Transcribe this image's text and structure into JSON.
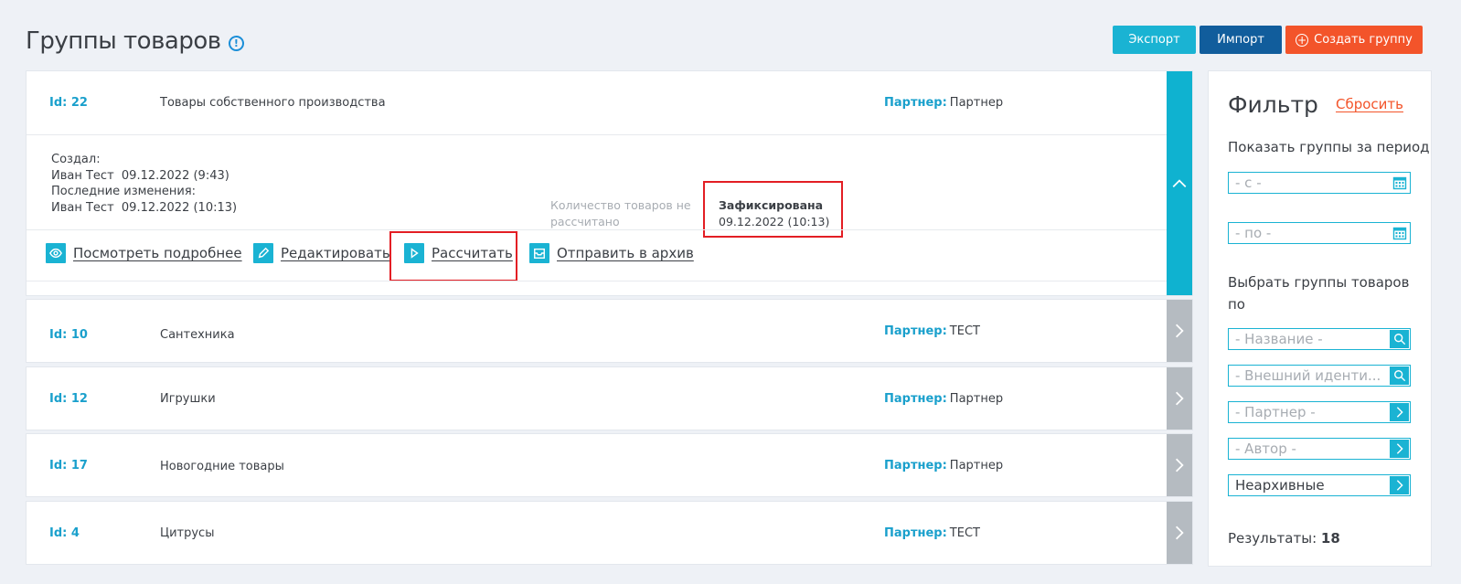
{
  "page": {
    "title": "Группы товаров"
  },
  "toolbar": {
    "export_label": "Экспорт",
    "import_label": "Импорт",
    "create_label": "Создать группу"
  },
  "groups": [
    {
      "id": "Id: 22",
      "name": "Товары собственного производства",
      "partner_label": "Партнер:",
      "partner": "Партнер",
      "created_label": "Создал:",
      "created_by": "Иван Тест  09.12.2022 (9:43)",
      "modified_label": "Последние изменения:",
      "modified_by": "Иван Тест  09.12.2022 (10:13)",
      "qty_status": "Количество товаров не рассчитано",
      "status_title": "Зафиксирована",
      "status_date": "09.12.2022 (10:13)",
      "actions": {
        "view": "Посмотреть подробнее",
        "edit": "Редактировать",
        "calculate": "Рассчитать",
        "archive": "Отправить в архив"
      }
    },
    {
      "id": "Id: 10",
      "name": "Сантехника",
      "partner_label": "Партнер:",
      "partner": "ТЕСТ"
    },
    {
      "id": "Id: 12",
      "name": "Игрушки",
      "partner_label": "Партнер:",
      "partner": "Партнер"
    },
    {
      "id": "Id: 17",
      "name": "Новогодние товары",
      "partner_label": "Партнер:",
      "partner": "Партнер"
    },
    {
      "id": "Id: 4",
      "name": "Цитрусы",
      "partner_label": "Партнер:",
      "partner": "ТЕСТ"
    }
  ],
  "filter": {
    "title": "Фильтр",
    "reset_label": "Сбросить",
    "period_label": "Показать группы за период",
    "date_from_placeholder": "- с -",
    "date_to_placeholder": "- по -",
    "select_by_label": "Выбрать группы товаров по",
    "name_placeholder": "- Название -",
    "external_id_placeholder": "- Внешний иденти...",
    "partner_placeholder": "- Партнер -",
    "author_placeholder": "- Автор -",
    "archive_value": "Неархивные",
    "results_label": "Результаты:",
    "results_count": "18"
  },
  "colors": {
    "accent": "#1ab3d3",
    "import": "#115d9c",
    "create": "#f3542a",
    "highlight": "#e31e24"
  }
}
